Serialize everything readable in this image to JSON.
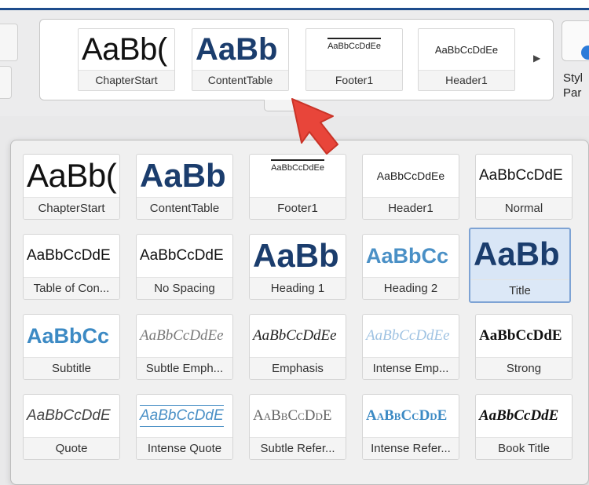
{
  "ribbon": {
    "styles": [
      {
        "name": "ChapterStart",
        "sample": "AaBb("
      },
      {
        "name": "ContentTable",
        "sample": "AaBb"
      },
      {
        "name": "Footer1",
        "sample": "AaBbCcDdEe"
      },
      {
        "name": "Header1",
        "sample": "AaBbCcDdEe"
      }
    ],
    "pane_label_line1": "Styl",
    "pane_label_line2": "Par"
  },
  "gallery": {
    "rows": [
      [
        {
          "name": "ChapterStart",
          "sample": "AaBb("
        },
        {
          "name": "ContentTable",
          "sample": "AaBb"
        },
        {
          "name": "Footer1",
          "sample": "AaBbCcDdEe"
        },
        {
          "name": "Header1",
          "sample": "AaBbCcDdEe"
        },
        {
          "name": "Normal",
          "sample": "AaBbCcDdE"
        }
      ],
      [
        {
          "name": "Table of Con...",
          "sample": "AaBbCcDdE"
        },
        {
          "name": "No Spacing",
          "sample": "AaBbCcDdE"
        },
        {
          "name": "Heading 1",
          "sample": "AaBb"
        },
        {
          "name": "Heading 2",
          "sample": "AaBbCc"
        },
        {
          "name": "Title",
          "sample": "AaBb"
        }
      ],
      [
        {
          "name": "Subtitle",
          "sample": "AaBbCc"
        },
        {
          "name": "Subtle Emph...",
          "sample": "AaBbCcDdEe"
        },
        {
          "name": "Emphasis",
          "sample": "AaBbCcDdEe"
        },
        {
          "name": "Intense Emp...",
          "sample": "AaBbCcDdEe"
        },
        {
          "name": "Strong",
          "sample": "AaBbCcDdE"
        }
      ],
      [
        {
          "name": "Quote",
          "sample": "AaBbCcDdE"
        },
        {
          "name": "Intense Quote",
          "sample": "AaBbCcDdE"
        },
        {
          "name": "Subtle Refer...",
          "sample": "AaBbCcDdE"
        },
        {
          "name": "Intense Refer...",
          "sample": "AaBbCcDdE"
        },
        {
          "name": "Book Title",
          "sample": "AaBbCcDdE"
        }
      ]
    ],
    "selected": "Title"
  },
  "colors": {
    "accent_blue": "#1e4c8c",
    "heading_navy": "#1b3d6d",
    "heading_light_blue": "#4a90c6",
    "selection_border": "#7ea3d4",
    "annotation_arrow": "#e8453a"
  },
  "icons": {
    "ribbon_arrow": "▶"
  }
}
